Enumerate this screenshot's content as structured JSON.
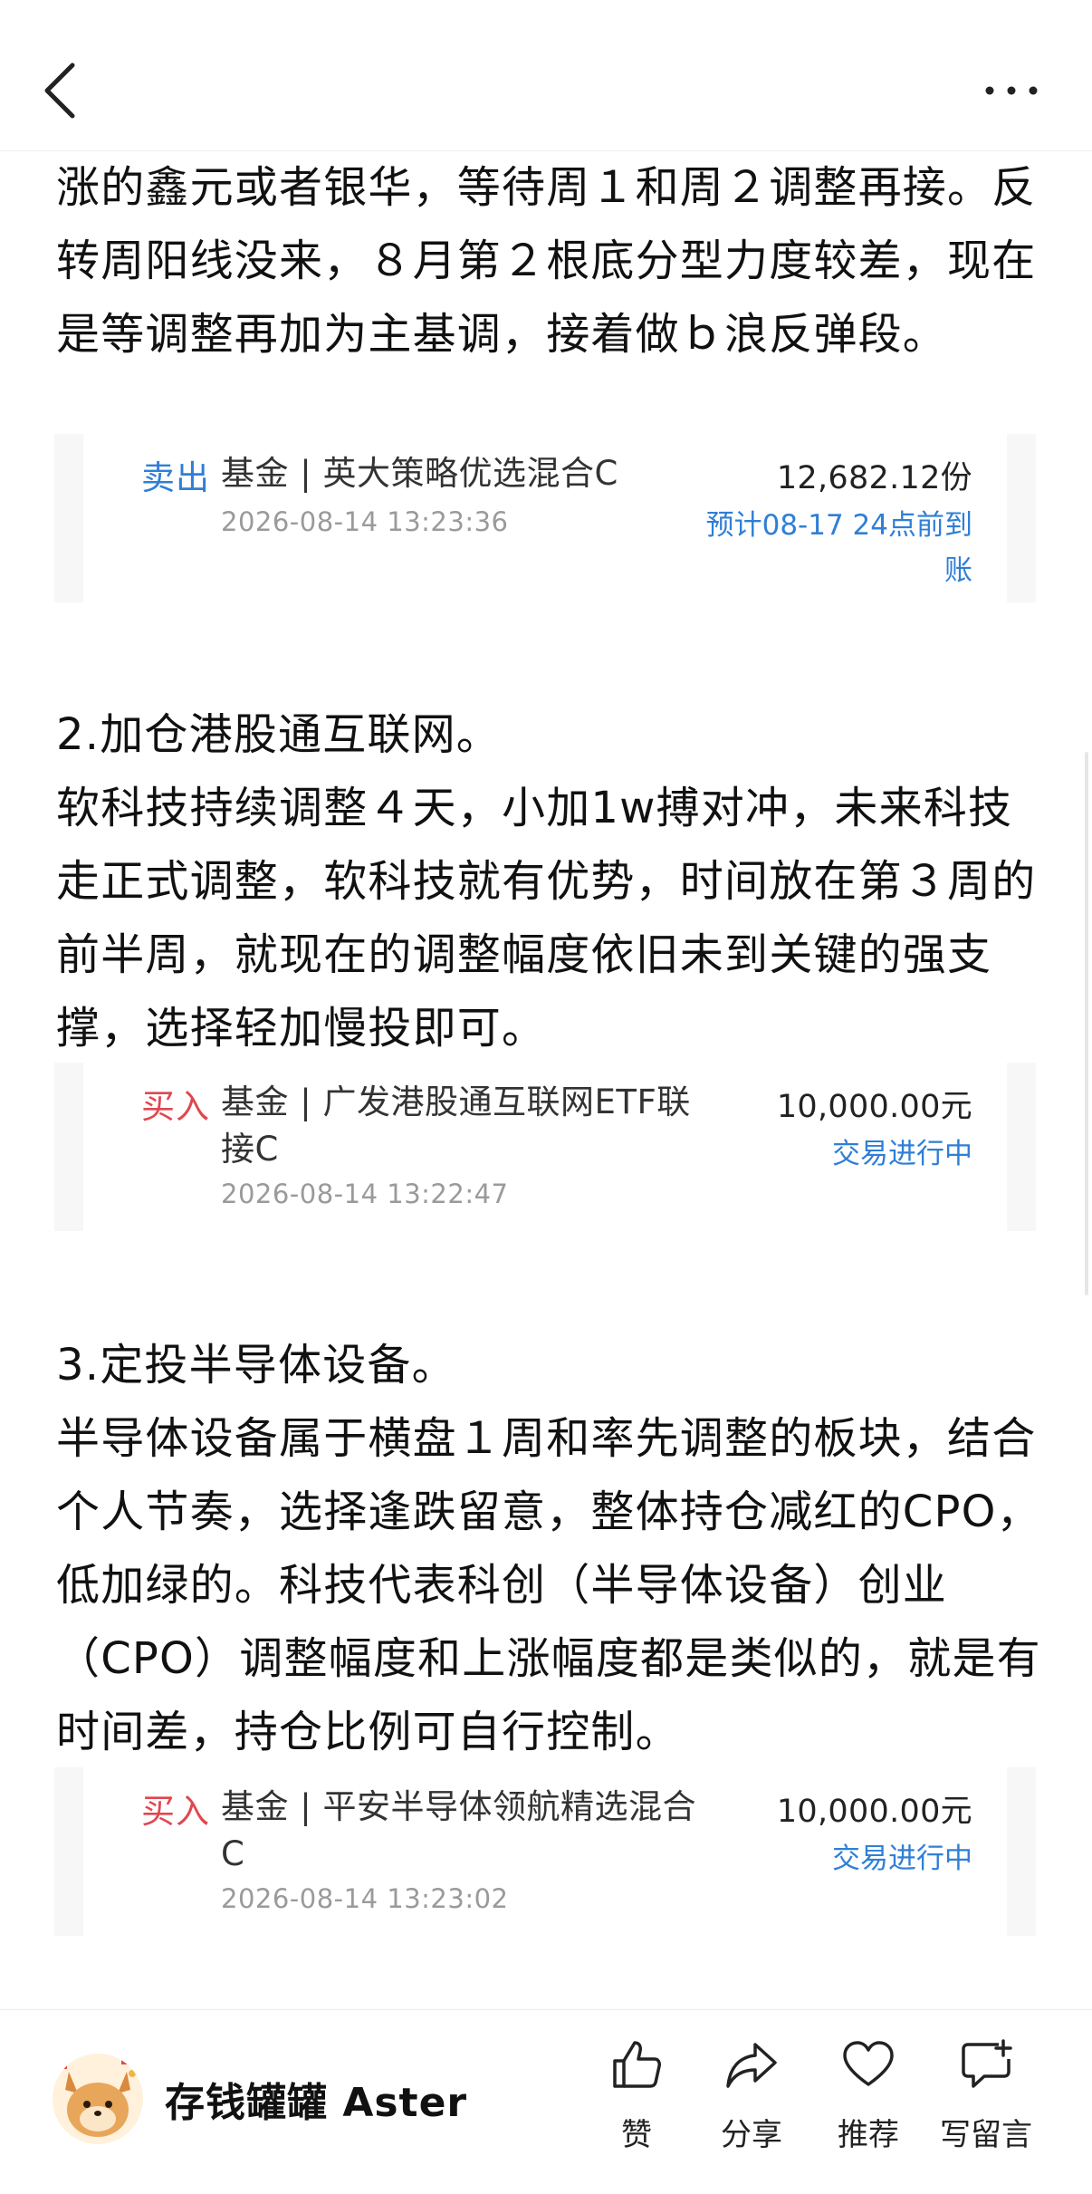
{
  "header": {
    "back_icon": "chevron-left-icon",
    "more_icon": "more-dots-icon"
  },
  "content": {
    "para1": "涨的鑫元或者银华，等待周１和周２调整再接。反转周阳线没来，８月第２根底分型力度较差，现在是等调整再加为主基调，接着做ｂ浪反弹段。",
    "card1": {
      "type": "卖出",
      "fund": "基金 | 英大策略优选混合C",
      "time": "2026-08-14 13:23:36",
      "amount": "12,682.12份",
      "status": "预计08-17 24点前到账"
    },
    "para2_title": "2.加仓港股通互联网。",
    "para2": "软科技持续调整４天，小加1w搏对冲，未来科技走正式调整，软科技就有优势，时间放在第３周的前半周，就现在的调整幅度依旧未到关键的强支撑，选择轻加慢投即可。",
    "card2": {
      "type": "买入",
      "fund": "基金 | 广发港股通互联网ETF联接C",
      "time": "2026-08-14 13:22:47",
      "amount": "10,000.00元",
      "status": "交易进行中"
    },
    "para3_title": "3.定投半导体设备。",
    "para3": "半导体设备属于横盘１周和率先调整的板块，结合个人节奏，选择逢跌留意，整体持仓减红的CPO，低加绿的。科技代表科创（半导体设备）创业（CPO）调整幅度和上涨幅度都是类似的，就是有时间差，持仓比例可自行控制。",
    "card3": {
      "type": "买入",
      "fund": "基金 | 平安半导体领航精选混合C",
      "time": "2026-08-14 13:23:02",
      "amount": "10,000.00元",
      "status": "交易进行中"
    }
  },
  "bottom": {
    "author": "存钱罐罐 Aster",
    "actions": [
      {
        "label": "赞",
        "icon": "thumbs-up-icon"
      },
      {
        "label": "分享",
        "icon": "share-icon"
      },
      {
        "label": "推荐",
        "icon": "heart-icon"
      },
      {
        "label": "写留言",
        "icon": "comment-add-icon"
      }
    ]
  },
  "colors": {
    "sell": "#2f7fd6",
    "buy": "#e0474f",
    "status": "#2f7fd6"
  }
}
